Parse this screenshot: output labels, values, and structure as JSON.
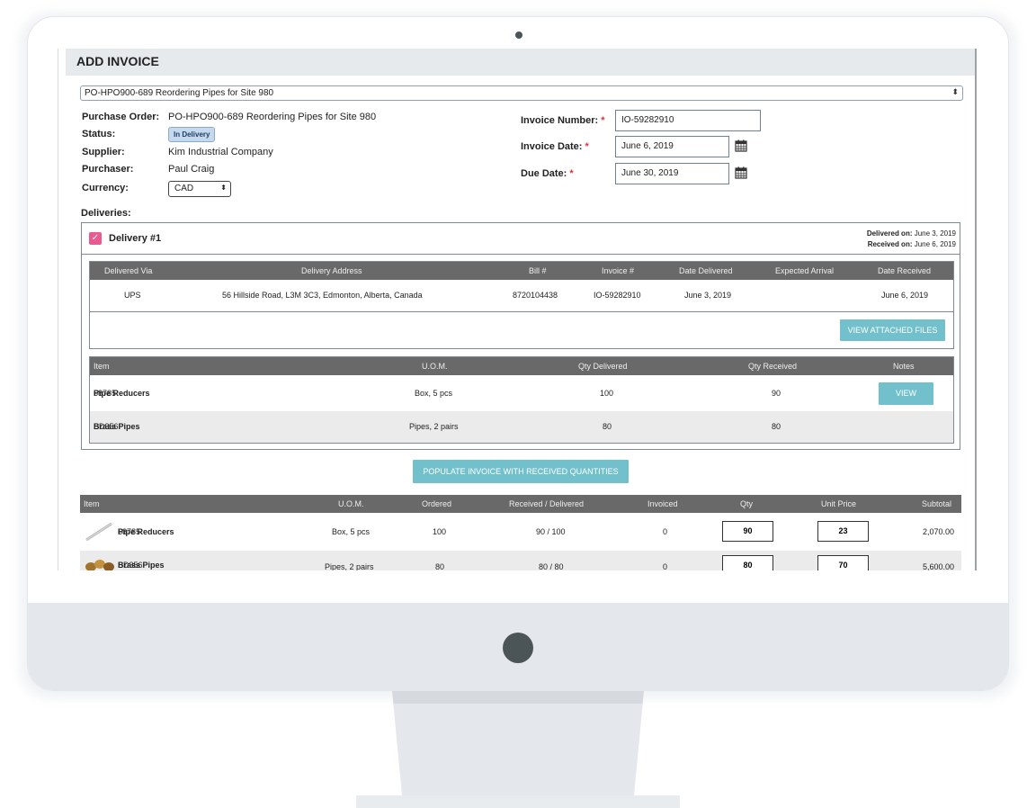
{
  "page": {
    "title": "ADD INVOICE"
  },
  "po_select": {
    "value": "PO-HPO900-689 Reordering Pipes for Site 980"
  },
  "info": {
    "purchase_order_label": "Purchase Order:",
    "purchase_order_value": "PO-HPO900-689 Reordering Pipes for Site 980",
    "status_label": "Status:",
    "status_value": "In Delivery",
    "supplier_label": "Supplier:",
    "supplier_value": "Kim Industrial Company",
    "purchaser_label": "Purchaser:",
    "purchaser_value": "Paul Craig",
    "currency_label": "Currency:",
    "currency_value": "CAD"
  },
  "invoice": {
    "number_label": "Invoice Number:",
    "number_value": "IO-59282910",
    "date_label": "Invoice Date:",
    "date_value": "June 6, 2019",
    "due_label": "Due Date:",
    "due_value": "June 30, 2019",
    "required_mark": "*"
  },
  "deliveries": {
    "label": "Deliveries:",
    "title": "Delivery #1",
    "delivered_on_label": "Delivered on:",
    "delivered_on_value": "June 3, 2019",
    "received_on_label": "Received on:",
    "received_on_value": "June 6, 2019",
    "headers": [
      "Delivered Via",
      "Delivery Address",
      "Bill #",
      "Invoice #",
      "Date Delivered",
      "Expected Arrival",
      "Date Received"
    ],
    "row": [
      "UPS",
      "56 Hillside Road, L3M 3C3, Edmonton, Alberta, Canada",
      "8720104438",
      "IO-59282910",
      "June 3, 2019",
      "",
      "June 6, 2019"
    ],
    "view_files_label": "VIEW ATTACHED FILES",
    "item_headers": [
      "Item",
      "U.O.M.",
      "Qty Delivered",
      "Qty Received",
      "Notes"
    ],
    "items": [
      {
        "code": "68785",
        "name": "Pipe Reducers",
        "uom": "Box, 5 pcs",
        "delivered": "100",
        "received": "90",
        "notes_btn": "VIEW"
      },
      {
        "code": "SD356",
        "name": "Brass Pipes",
        "uom": "Pipes, 2 pairs",
        "delivered": "80",
        "received": "80",
        "notes_btn": ""
      }
    ]
  },
  "populate_button": "POPULATE INVOICE WITH RECEIVED QUANTITIES",
  "invoice_items": {
    "headers": [
      "Item",
      "U.O.M.",
      "Ordered",
      "Received / Delivered",
      "Invoiced",
      "Qty",
      "Unit Price",
      "Subtotal"
    ],
    "rows": [
      {
        "code": "68785",
        "name": "Pipe Reducers",
        "uom": "Box, 5 pcs",
        "ordered": "100",
        "rec_del": "90 / 100",
        "invoiced": "0",
        "qty": "90",
        "unit_price": "23",
        "subtotal": "2,070.00"
      },
      {
        "code": "SD356",
        "name": "Brass Pipes",
        "uom": "Pipes, 2 pairs",
        "ordered": "80",
        "rec_del": "80 / 80",
        "invoiced": "0",
        "qty": "80",
        "unit_price": "70",
        "subtotal": "5,600.00"
      }
    ]
  },
  "colors": {
    "accent": "#73c0cd",
    "checkbox": "#ea5a91",
    "table_header": "#696969",
    "required": "#e0313a"
  }
}
